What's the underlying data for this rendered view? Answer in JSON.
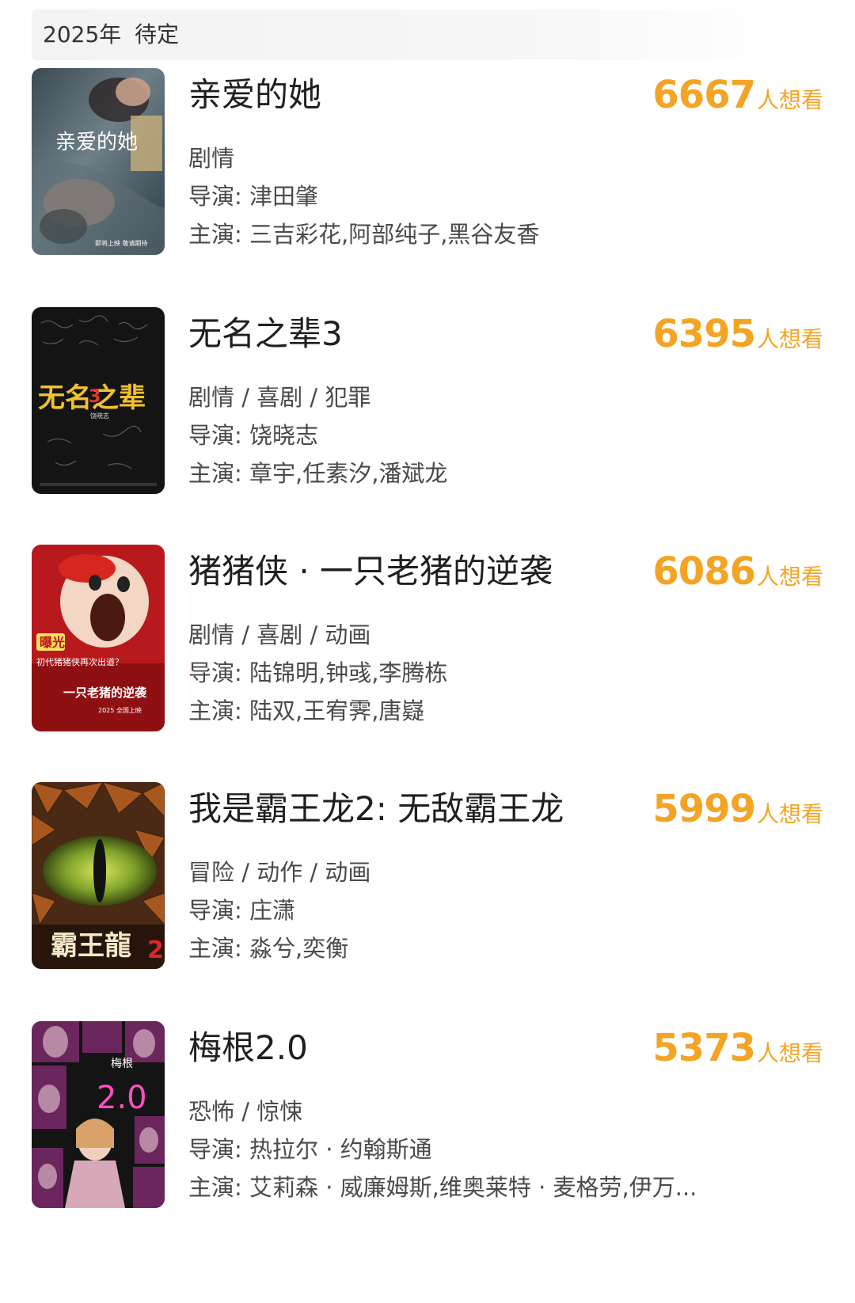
{
  "section": {
    "year": "2025年",
    "status": "待定"
  },
  "want_suffix": "人想看",
  "movies": [
    {
      "title": "亲爱的她",
      "want_count": "6667",
      "genres": "剧情",
      "director": "导演: 津田肇",
      "cast": "主演: 三吉彩花,阿部纯子,黑谷友香",
      "poster": {
        "title_text": "亲爱的她",
        "bottom_text": "即将上映 敬请期待"
      }
    },
    {
      "title": "无名之辈3",
      "want_count": "6395",
      "genres": "剧情 / 喜剧 / 犯罪",
      "director": "导演: 饶晓志",
      "cast": "主演: 章宇,任素汐,潘斌龙",
      "poster": {
        "title_text": "无名之辈",
        "number_text": "3",
        "sub_text": "饶晓志"
      }
    },
    {
      "title": "猪猪侠 · 一只老猪的逆袭",
      "want_count": "6086",
      "genres": "剧情 / 喜剧 / 动画",
      "director": "导演: 陆锦明,钟彧,李腾栋",
      "cast": "主演: 陆双,王宥霁,唐嶷",
      "poster": {
        "badge_text": "曝光",
        "line1": "初代猪猪侠再次出道？",
        "title_text": "一只老猪的逆袭",
        "year_text": "2025 全国上映"
      }
    },
    {
      "title": "我是霸王龙2: 无敌霸王龙",
      "want_count": "5999",
      "genres": "冒险 / 动作 / 动画",
      "director": "导演: 庄潇",
      "cast": "主演: 淼兮,奕衡",
      "poster": {
        "title_text": "霸王龍",
        "number_text": "2"
      }
    },
    {
      "title": "梅根2.0",
      "want_count": "5373",
      "genres": "恐怖 / 惊悚",
      "director": "导演: 热拉尔 · 约翰斯通",
      "cast": "主演: 艾莉森 · 威廉姆斯,维奥莱特 · 麦格劳,伊万...",
      "poster": {
        "title_text": "梅根",
        "number_text": "2.0"
      }
    }
  ]
}
